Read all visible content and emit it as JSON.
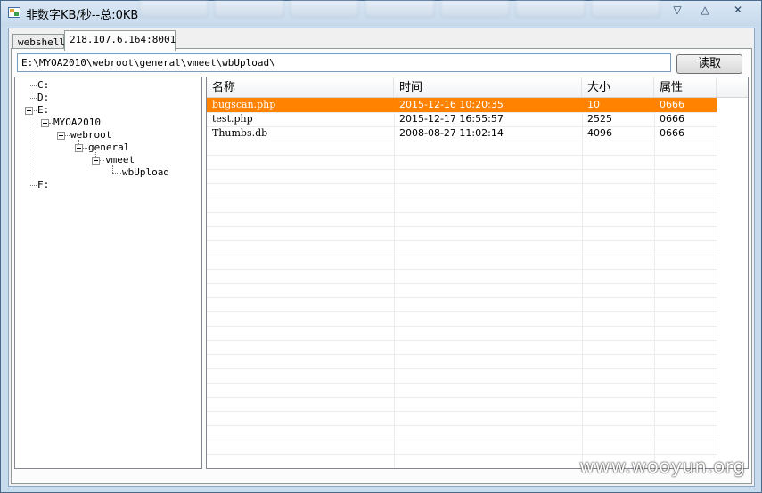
{
  "window": {
    "title": "非数字KB/秒--总:0KB",
    "buttons": {
      "minimize": "▽",
      "maximize": "△",
      "close": "✕"
    }
  },
  "tabs": [
    {
      "label": "webshell",
      "active": false
    },
    {
      "label": "218.107.6.164:8001",
      "active": true
    }
  ],
  "path": {
    "value": "E:\\MYOA2010\\webroot\\general\\vmeet\\wbUpload\\"
  },
  "read_button": {
    "label": "读取"
  },
  "tree": {
    "drive_c": "C:",
    "drive_d": "D:",
    "drive_e": "E:",
    "myoa2010": "MYOA2010",
    "webroot": "webroot",
    "general": "general",
    "vmeet": "vmeet",
    "wbupload": "wbUpload",
    "drive_f": "F:"
  },
  "files": {
    "columns": [
      "名称",
      "时间",
      "大小",
      "属性"
    ],
    "rows": [
      {
        "name": "bugscan.php",
        "time": "2015-12-16 10:20:35",
        "size": "10",
        "attr": "0666",
        "selected": true
      },
      {
        "name": "test.php",
        "time": "2015-12-17 16:55:57",
        "size": "2525",
        "attr": "0666",
        "selected": false
      },
      {
        "name": "Thumbs.db",
        "time": "2008-08-27 11:02:14",
        "size": "4096",
        "attr": "0666",
        "selected": false
      }
    ]
  },
  "watermark": "www.wooyun.org",
  "colors": {
    "selection": "#ff8200",
    "accent_border": "#7a9cbd"
  },
  "icons": {
    "app": "app-window-icon"
  }
}
